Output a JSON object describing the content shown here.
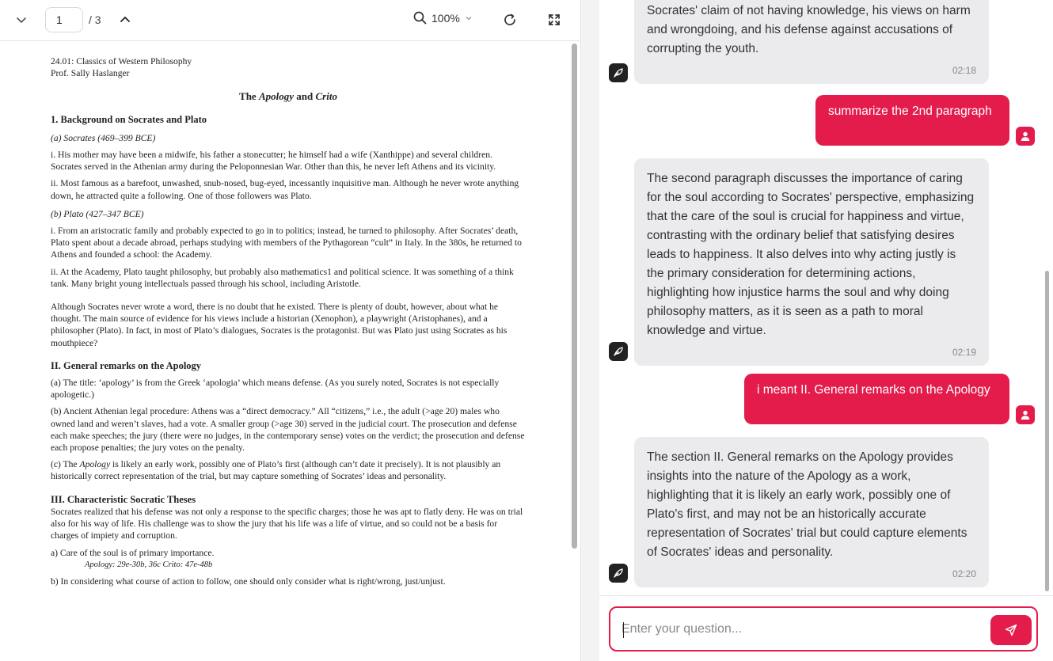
{
  "pdf_toolbar": {
    "page_current": "1",
    "page_total": "/ 3",
    "zoom": "100%"
  },
  "document": {
    "course": "24.01: Classics of Western Philosophy",
    "prof": "Prof. Sally Haslanger",
    "title_pre": "The ",
    "title_apology": "Apology",
    "title_mid": " and ",
    "title_crito": "Crito",
    "s1_heading": "1.  Background on Socrates and Plato",
    "s1_a": "(a) Socrates (469–399 BCE)",
    "s1_a_i": "i. His mother may have been a midwife, his father a stonecutter; he himself had a wife (Xanthippe) and several children. Socrates served in the Athenian army during the Peloponnesian War. Other than this, he never left Athens and its vicinity.",
    "s1_a_ii": "ii. Most famous as a barefoot, unwashed, snub-nosed, bug-eyed, incessantly inquisitive man. Although he never wrote anything down, he attracted quite a following. One of those followers was Plato.",
    "s1_b": "(b) Plato (427–347 BCE)",
    "s1_b_i": "i. From an aristocratic family and probably expected to go in to politics; instead, he turned to philosophy. After Socrates’ death, Plato spent about a decade abroad, perhaps studying with members of the Pythagorean “cult” in Italy. In the 380s, he returned to Athens and founded a school: the Academy.",
    "s1_b_ii": "ii. At the Academy, Plato taught philosophy, but probably also mathematics1 and political science. It was something of a think tank. Many bright young intellectuals passed through his school, including Aristotle.",
    "s1_p": "Although Socrates never wrote a word, there is no doubt that he existed.  There is plenty of doubt, however, about what he thought.  The main source of evidence for his views include a historian (Xenophon), a playwright (Aristophanes), and a philosopher (Plato).  In fact, in most of Plato’s dialogues, Socrates is the protagonist.  But was Plato just using Socrates as his mouthpiece?",
    "s2_heading": "II.  General remarks on the Apology",
    "s2_a": "(a) The title: ‘apology’ is from the Greek ‘apologia’ which means defense. (As you surely noted, Socrates is not especially apologetic.)",
    "s2_b": "(b) Ancient Athenian legal procedure:  Athens was a “direct democracy.”  All “citizens,” i.e., the adult (>age 20) males who owned land and weren’t slaves, had a vote.  A smaller group (>age 30) served in the judicial court.  The prosecution and defense each make speeches; the jury (there were no judges, in the contemporary sense) votes on the verdict; the prosecution and defense each propose penalties; the jury votes on the penalty.",
    "s2_c_pre": "(c) The ",
    "s2_c_apology": "Apology",
    "s2_c_post": " is likely an early work, possibly one of Plato’s first (although can’t date it precisely).  It is not plausibly an historically correct representation of the trial, but may capture something of Socrates’ ideas and personality.",
    "s3_heading": "III. Characteristic Socratic Theses",
    "s3_p": "Socrates realized that his defense was not only a response to the specific charges; those he was apt to flatly deny.  He was on trial also for his way of life.  His challenge was to show the jury that his life was a life of virtue, and so could not be a basis for charges of impiety and corruption.",
    "s3_a": "a)  Care of the soul is of primary importance.",
    "s3_a_ref": "Apology: 29e-30b, 36c      Crito: 47e-48b",
    "s3_b": "b)  In considering what course of action to follow, one should only consider what is right/wrong, just/unjust."
  },
  "chat": {
    "messages": [
      {
        "role": "bot",
        "text": "Socrates' claim of not having knowledge, his views on harm and wrongdoing, and his defense against accusations of corrupting the youth.",
        "time": "02:18"
      },
      {
        "role": "user",
        "text": "summarize the 2nd paragraph"
      },
      {
        "role": "bot",
        "text": "The second paragraph discusses the importance of caring for the soul according to Socrates' perspective, emphasizing that the care of the soul is crucial for happiness and virtue, contrasting with the ordinary belief that satisfying desires leads to happiness. It also delves into why acting justly is the primary consideration for determining actions, highlighting how injustice harms the soul and why doing philosophy matters, as it is seen as a path to moral knowledge and virtue.",
        "time": "02:19"
      },
      {
        "role": "user",
        "text": "i meant II. General remarks on the Apology"
      },
      {
        "role": "bot",
        "text": "The section II. General remarks on the Apology provides insights into the nature of the Apology as a work, highlighting that it is likely an early work, possibly one of Plato's first, and may not be an historically accurate representation of Socrates' trial but could capture elements of Socrates' ideas and personality.",
        "time": "02:20"
      }
    ],
    "input_placeholder": "Enter your question..."
  },
  "colors": {
    "accent": "#e31c4c",
    "bot_bubble": "#ebebee"
  },
  "icons": [
    "chevron-down-icon",
    "chevron-up-icon",
    "search-icon",
    "refresh-icon",
    "fullscreen-icon",
    "feather-icon",
    "user-icon",
    "send-icon"
  ]
}
